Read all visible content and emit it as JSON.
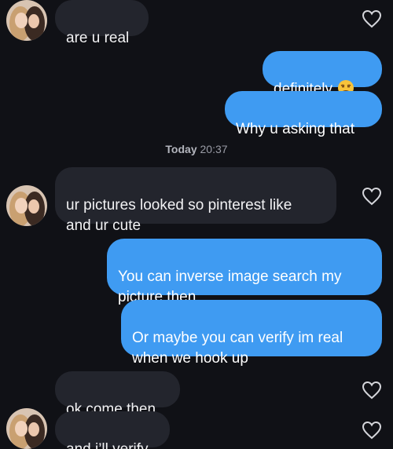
{
  "colors": {
    "background": "#101116",
    "incoming_bubble": "#23252d",
    "outgoing_bubble": "#3f9bf2",
    "timestamp_text": "#9a9ca6"
  },
  "messages": [
    {
      "id": "m1",
      "direction": "incoming",
      "text": "are u real",
      "has_avatar": true,
      "icon": "heart-outline-icon"
    },
    {
      "id": "m2",
      "direction": "outgoing",
      "text": "definitely",
      "emoji": "unamused-face-emoji"
    },
    {
      "id": "m3",
      "direction": "outgoing",
      "text": "Why u asking that"
    },
    {
      "id": "m4",
      "direction": "incoming",
      "text": "ur pictures looked so pinterest like\nand ur cute",
      "has_avatar": true,
      "icon": "heart-outline-icon"
    },
    {
      "id": "m5",
      "direction": "outgoing",
      "text": "You can inverse image search my\npicture then"
    },
    {
      "id": "m6",
      "direction": "outgoing",
      "text": "Or maybe you can verify im real\nwhen we hook up"
    },
    {
      "id": "m7",
      "direction": "incoming",
      "text": "ok come then",
      "has_avatar": false,
      "icon": "heart-outline-icon"
    },
    {
      "id": "m8",
      "direction": "incoming",
      "text": "and i’ll verify",
      "has_avatar": true,
      "icon": "heart-outline-icon"
    }
  ],
  "separator": {
    "day": "Today",
    "time": "20:37"
  }
}
